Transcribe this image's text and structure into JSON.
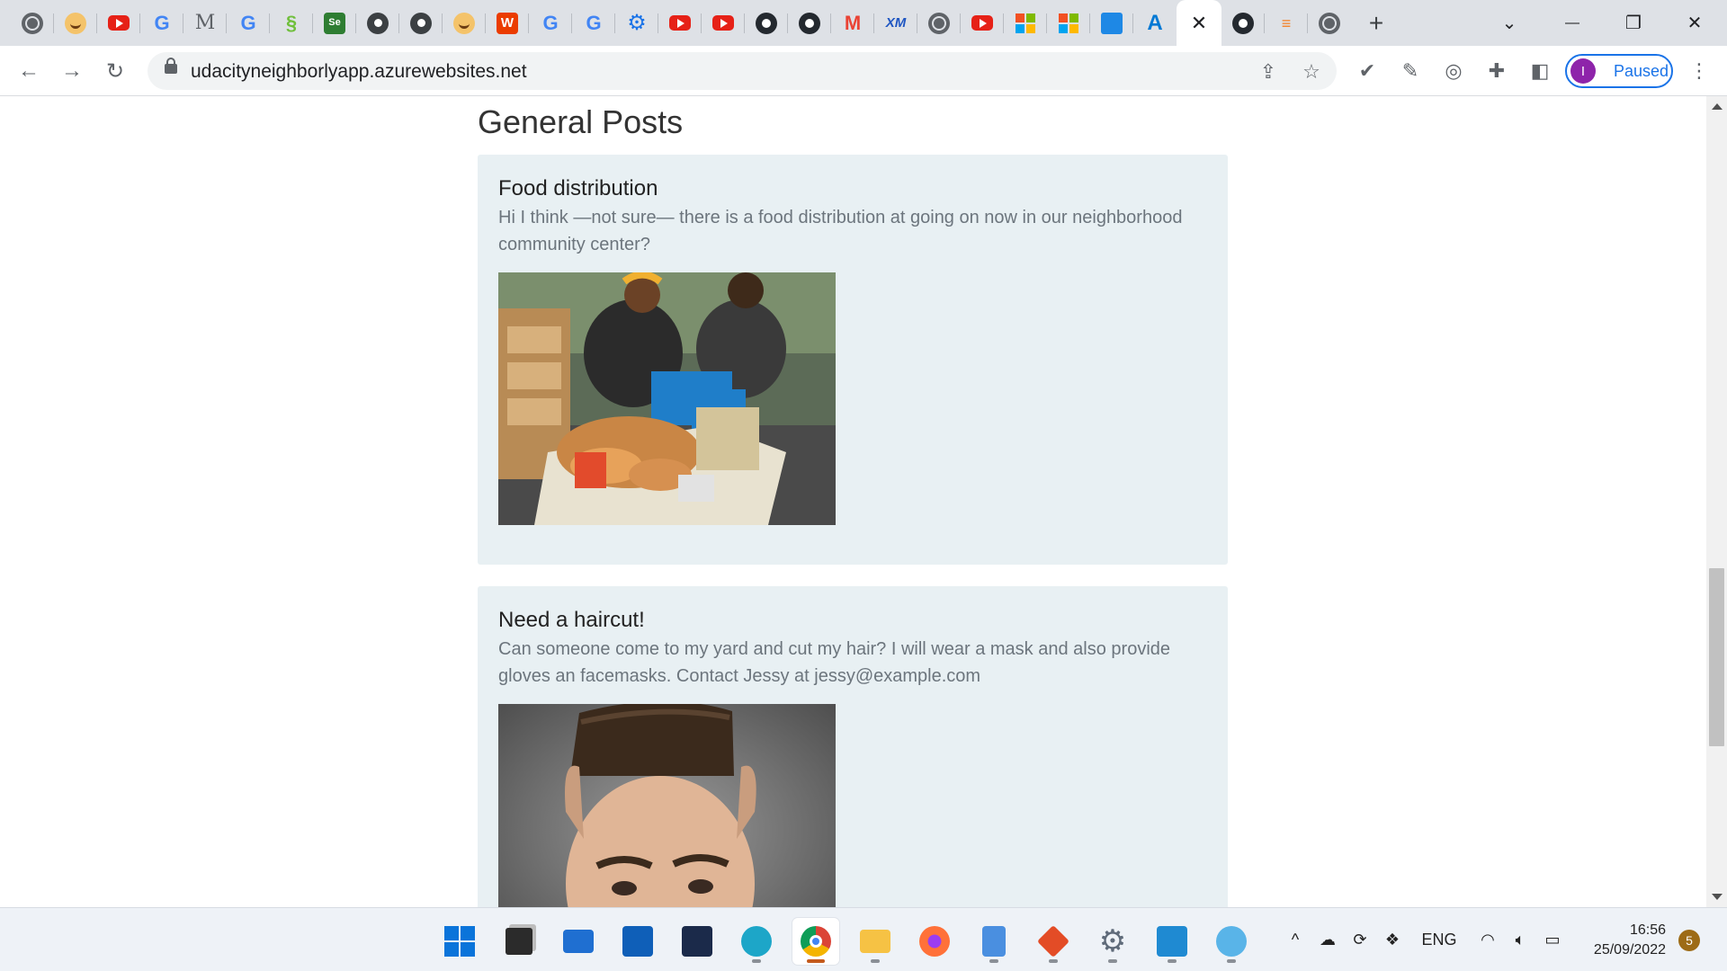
{
  "browser": {
    "tabs": [
      {
        "icon": "globe-icon",
        "kind": "globe"
      },
      {
        "icon": "face-icon",
        "kind": "face"
      },
      {
        "icon": "youtube-icon",
        "kind": "yt"
      },
      {
        "icon": "google-icon",
        "kind": "g",
        "glyph": "G"
      },
      {
        "icon": "medium-icon",
        "kind": "m",
        "glyph": "M"
      },
      {
        "icon": "google-icon",
        "kind": "g",
        "glyph": "G"
      },
      {
        "icon": "green-app-icon",
        "kind": "green",
        "glyph": "§"
      },
      {
        "icon": "selenium-icon",
        "kind": "se",
        "glyph": "Se"
      },
      {
        "icon": "chrome-icon",
        "kind": "chrome"
      },
      {
        "icon": "chrome-icon",
        "kind": "chrome"
      },
      {
        "icon": "face-icon",
        "kind": "face"
      },
      {
        "icon": "office-icon",
        "kind": "office",
        "glyph": "W"
      },
      {
        "icon": "google-icon",
        "kind": "g",
        "glyph": "G"
      },
      {
        "icon": "google-icon",
        "kind": "g",
        "glyph": "G"
      },
      {
        "icon": "gear-icon",
        "kind": "gear",
        "glyph": "⚙"
      },
      {
        "icon": "youtube-icon",
        "kind": "yt"
      },
      {
        "icon": "youtube-icon",
        "kind": "yt"
      },
      {
        "icon": "github-icon",
        "kind": "gh"
      },
      {
        "icon": "circle-app-icon",
        "kind": "gh"
      },
      {
        "icon": "gmail-icon",
        "kind": "gmail",
        "glyph": "M"
      },
      {
        "icon": "xm-icon",
        "kind": "xm",
        "glyph": "XM"
      },
      {
        "icon": "globe-icon",
        "kind": "globe"
      },
      {
        "icon": "youtube-icon",
        "kind": "yt"
      },
      {
        "icon": "microsoft-icon",
        "kind": "ms"
      },
      {
        "icon": "microsoft-icon",
        "kind": "ms"
      },
      {
        "icon": "blue-app-icon",
        "kind": "blue2"
      },
      {
        "icon": "azure-icon",
        "kind": "azure",
        "glyph": "A"
      },
      {
        "icon": "close-icon",
        "kind": "active",
        "glyph": "✕"
      },
      {
        "icon": "github-icon",
        "kind": "gh"
      },
      {
        "icon": "stackoverflow-icon",
        "kind": "bars",
        "glyph": "≡"
      },
      {
        "icon": "globe-icon",
        "kind": "globe"
      }
    ],
    "new_tab_glyph": "+",
    "window_controls": {
      "dropdown": "⌄",
      "minimize": "—",
      "restore": "❐",
      "close": "✕"
    },
    "address": "udacityneighborlyapp.azurewebsites.net",
    "profile": {
      "initial": "I",
      "status": "Paused"
    }
  },
  "page": {
    "section_title": "General Posts",
    "posts": [
      {
        "title": "Food distribution",
        "body": "Hi I think —not sure— there is a food distribution at going on now in our neighborhood community center?",
        "image": "food-distribution-photo"
      },
      {
        "title": "Need a haircut!",
        "body": "Can someone come to my yard and cut my hair? I will wear a mask and also provide gloves an facemasks. Contact Jessy at jessy@example.com",
        "image": "haircut-photo"
      }
    ]
  },
  "taskbar": {
    "apps": [
      "windows-start-icon",
      "task-view-icon",
      "mail-icon",
      "store-icon",
      "terminal-icon",
      "edge-icon",
      "chrome-icon",
      "file-explorer-icon",
      "firefox-icon",
      "notepad-icon",
      "git-icon",
      "settings-icon",
      "vscode-icon",
      "paint-icon"
    ],
    "active_app": "chrome-icon",
    "language": "ENG",
    "time": "16:56",
    "date": "25/09/2022",
    "notifications": "5"
  },
  "colors": {
    "post_background": "#e8f0f3",
    "body_text": "#6c757d",
    "profile_accent": "#1a73e8"
  }
}
